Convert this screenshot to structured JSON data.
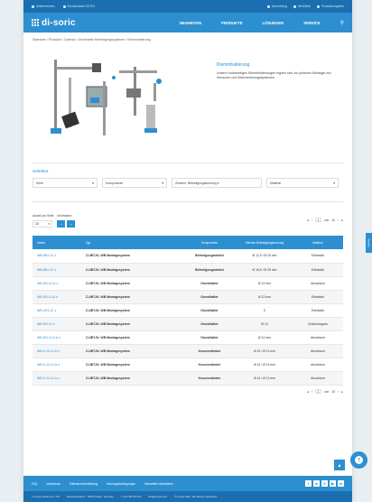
{
  "topbar": {
    "left": [
      {
        "icon": "building-icon",
        "label": "Unternehmen"
      },
      {
        "icon": "globe-icon",
        "label": "Deutschland  DE  EN"
      }
    ],
    "right": [
      {
        "icon": "user-icon",
        "label": "Anmeldung"
      },
      {
        "icon": "list-icon",
        "label": "Merkliste"
      },
      {
        "icon": "compare-icon",
        "label": "Produktvergleich"
      }
    ]
  },
  "nav": {
    "logo": "di-soric",
    "menu": [
      "NEUHEITEN",
      "PRODUKTE",
      "LÖSUNGEN",
      "SERVICE"
    ],
    "search_icon": "search-icon"
  },
  "breadcrumb": "Startseite / Produkte / Zubehör / Universelle Befestigungssysteme / Klemmhalterung",
  "hero": {
    "title": "Klemmhalterung",
    "description": "Unsere hochwertigen Klemmhalterungen eignen sich zur präzisen Montage von Sensoren und Wahrnehmungssystemen."
  },
  "selektor": {
    "title": "Selektor",
    "filters": [
      "Serie",
      "Komponente",
      "Zeichen, Befestigungsbohrung ▾",
      "Material"
    ]
  },
  "controls": {
    "per_page_label": "Anzahl pro Seite",
    "per_page_value": "10",
    "info_label": "Information",
    "info_buttons": [
      "−",
      "+"
    ],
    "pager": {
      "page": "1",
      "of_label": "von",
      "total": "10"
    }
  },
  "table": {
    "headers": [
      "Artikel",
      "Typ",
      "Komponente",
      "Zeichen Befestigungsbohrung",
      "Material"
    ],
    "rows": [
      [
        "WB-BB1-12  ∨",
        "Z-UBT-KL WB Montagesystem",
        "Befestigungswinkel",
        "Ø 12,5 / Ø 25 mm",
        "Edelstahl"
      ],
      [
        "WB-BB1-12  ∨",
        "Z-UBT-KL WB Montagesystem",
        "Befestigungswinkel",
        "Ø 18,5 / Ø 25 mm",
        "Edelstahl"
      ],
      [
        "WB-GH-12-H  ∨",
        "Z-UBT-KL WB Montagesystem",
        "Grundhalter",
        "Ø 12 mm",
        "Aluminium"
      ],
      [
        "WB-GH-12-A  ∨",
        "Z-UBT-KL WB Montagesystem",
        "Grundhalter",
        "Ø 12 mm",
        "Edelstahl"
      ],
      [
        "WB-UH1-12  ∨",
        "Z-UBT-KL WB Montagesystem",
        "Grundhalter",
        "0",
        "Edelstahl"
      ],
      [
        "WB-GH-10  ∨",
        "Z-UBT-KL WB Montagesystem",
        "Grundhalter",
        "M 10",
        "Zinkdruckguss"
      ],
      [
        "WB-GH-4-12-A  ∨",
        "Z-UBT-KL WB Montagesystem",
        "Grundhalter",
        "Ø 12 mm",
        "Aluminium"
      ],
      [
        "WB-K-10-12-A  ∨",
        "Z-UBT-KL WB Montagesystem",
        "Kreuzverbinder",
        "Ø 10 / Ø 12 mm",
        "Aluminium"
      ],
      [
        "WB-K-12-12-A  ∨",
        "Z-UBT-KL WB Montagesystem",
        "Kreuzverbinder",
        "Ø 12 / Ø 12 mm",
        "Aluminium"
      ],
      [
        "WB-K-14-12-A  ∨",
        "Z-UBT-KL WB Montagesystem",
        "Kreuzverbinder",
        "Ø 14 / Ø 12 mm",
        "Aluminium"
      ]
    ]
  },
  "footer": {
    "links": [
      "FAQ",
      "Impressum",
      "Datenschutzerklärung",
      "Nutzungsbedingungen",
      "Newsletter abonnieren"
    ],
    "social": [
      "f",
      "in",
      "X",
      "▶",
      "in"
    ],
    "bottom": [
      "© di-soric GmbH & Co. KG",
      "Steinbeisstraße 6 · 73660 Urbach · Germany",
      "T +49 7181 98 79-0",
      "info@di-soric.com",
      "© di-soric 2022 · Alle Rechte vorbehalten"
    ]
  },
  "side_tab": "Kontakt",
  "colors": {
    "primary": "#2d8fd0",
    "dark": "#1b6fb0"
  }
}
